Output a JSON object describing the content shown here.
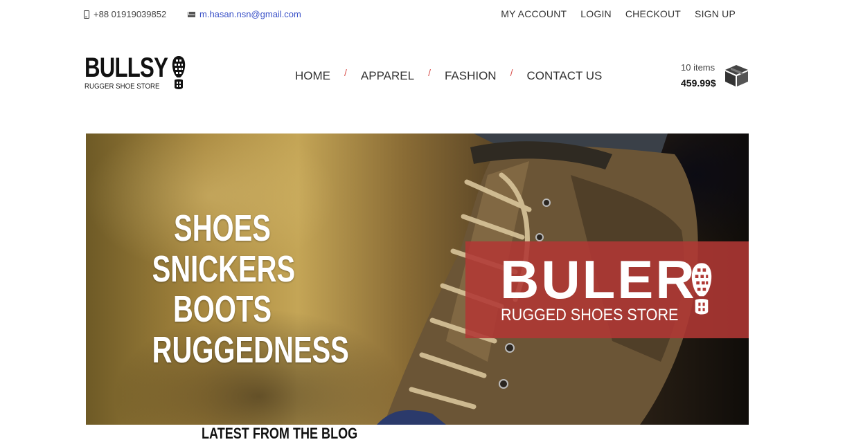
{
  "topbar": {
    "phone": "+88 01919039852",
    "email": "m.hasan.nsn@gmail.com",
    "account_links": [
      "MY ACCOUNT",
      "LOGIN",
      "CHECKOUT",
      "SIGN UP"
    ]
  },
  "header": {
    "logo_name": "BULLSY",
    "logo_tagline": "RUGGER SHOE STORE",
    "nav": [
      "HOME",
      "APPAREL",
      "FASHION",
      "CONTACT US"
    ],
    "nav_separator": "/",
    "cart": {
      "count_label": "10 items",
      "total": "459.99$"
    }
  },
  "hero": {
    "words": [
      "SHOES",
      "SNICKERS",
      "BOOTS",
      "RUGGEDNESS"
    ],
    "brand_name": "BULER",
    "brand_tagline": "RUGGED SHOES STORE"
  },
  "blog": {
    "heading": "LATEST FROM THE BLOG"
  },
  "colors": {
    "accent": "#d9534f",
    "email_link": "#3b52c8",
    "brand_box": "#b03834"
  },
  "icons": [
    "phone-icon",
    "mail-icon",
    "footprint-icon",
    "box-icon"
  ]
}
